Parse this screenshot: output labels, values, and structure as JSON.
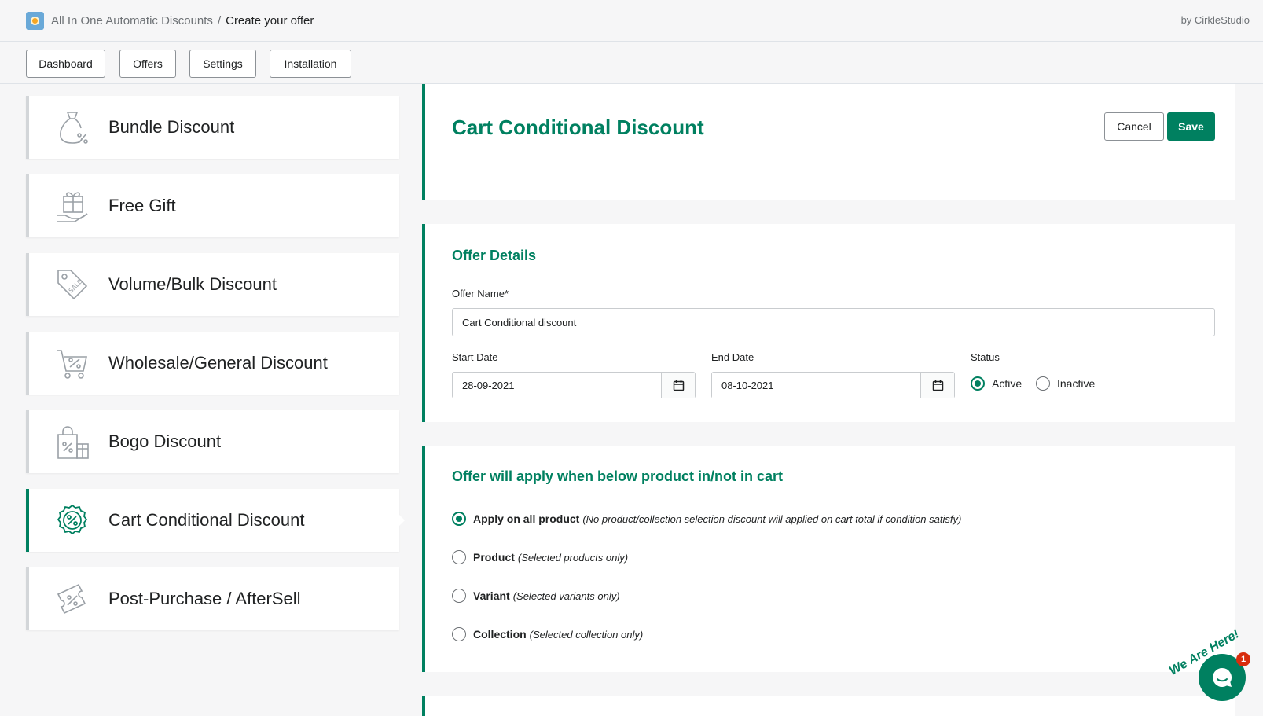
{
  "header": {
    "app_name": "All In One Automatic Discounts",
    "separator": "/",
    "page_title": "Create your offer",
    "byline": "by CirkleStudio"
  },
  "nav": {
    "tabs": [
      {
        "label": "Dashboard"
      },
      {
        "label": "Offers"
      },
      {
        "label": "Settings"
      },
      {
        "label": "Installation"
      }
    ]
  },
  "sidebar": {
    "items": [
      {
        "label": "Bundle Discount",
        "icon": "money-bag-percent-icon",
        "active": false
      },
      {
        "label": "Free Gift",
        "icon": "gift-hand-icon",
        "active": false
      },
      {
        "label": "Volume/Bulk Discount",
        "icon": "sale-tag-icon",
        "active": false
      },
      {
        "label": "Wholesale/General Discount",
        "icon": "cart-percent-icon",
        "active": false
      },
      {
        "label": "Bogo Discount",
        "icon": "shopping-bag-gift-icon",
        "active": false
      },
      {
        "label": "Cart Conditional Discount",
        "icon": "percent-badge-icon",
        "active": true
      },
      {
        "label": "Post-Purchase / AfterSell",
        "icon": "coupon-percent-icon",
        "active": false
      }
    ]
  },
  "title_card": {
    "title": "Cart Conditional Discount",
    "cancel_label": "Cancel",
    "save_label": "Save"
  },
  "offer_details": {
    "heading": "Offer Details",
    "offer_name_label": "Offer Name*",
    "offer_name_value": "Cart Conditional discount",
    "start_date_label": "Start Date",
    "start_date_value": "28-09-2021",
    "end_date_label": "End Date",
    "end_date_value": "08-10-2021",
    "status_label": "Status",
    "status_options": [
      {
        "label": "Active",
        "checked": true
      },
      {
        "label": "Inactive",
        "checked": false
      }
    ]
  },
  "apply_section": {
    "heading": "Offer will apply when below product in/not in cart",
    "options": [
      {
        "label": "Apply on all product",
        "hint": "(No product/collection selection discount will applied on cart total if condition satisfy)",
        "checked": true
      },
      {
        "label": "Product",
        "hint": "(Selected products only)",
        "checked": false
      },
      {
        "label": "Variant",
        "hint": "(Selected variants only)",
        "checked": false
      },
      {
        "label": "Collection",
        "hint": "(Selected collection only)",
        "checked": false
      }
    ]
  },
  "chat": {
    "text": "We Are Here!",
    "badge_count": "1"
  },
  "colors": {
    "accent": "#008060",
    "badge": "#d82c0d"
  }
}
